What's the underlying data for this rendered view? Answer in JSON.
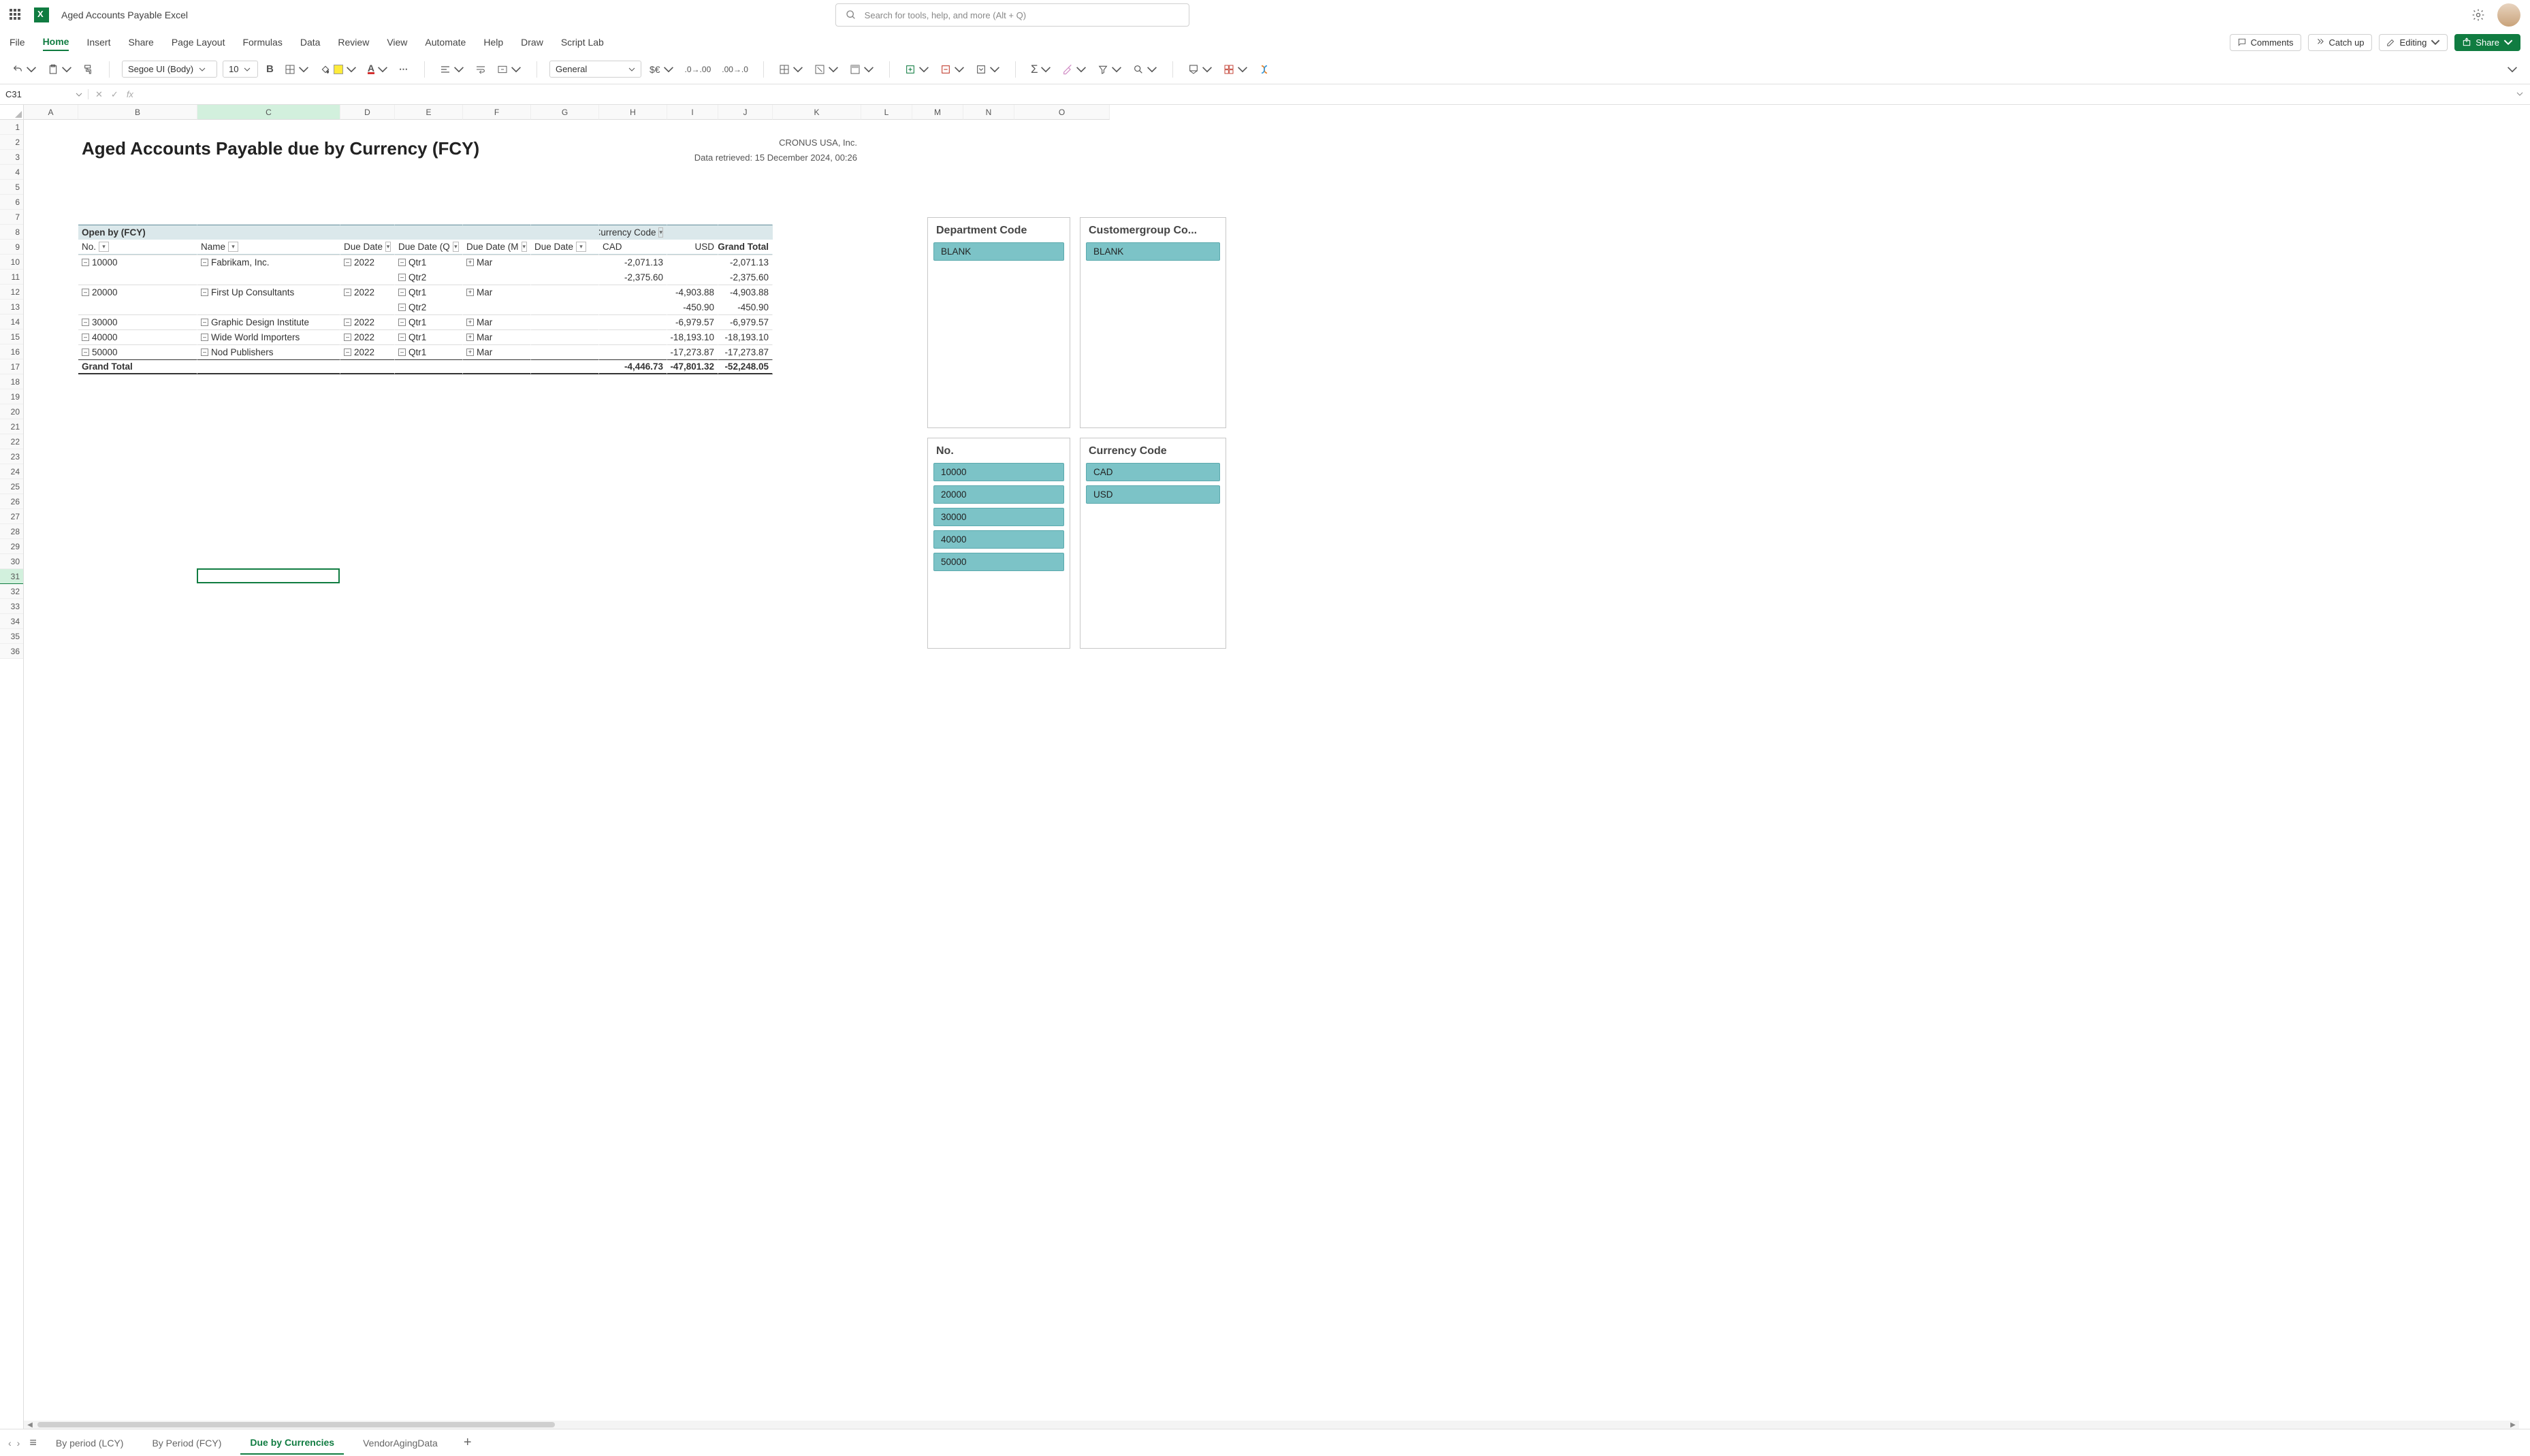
{
  "doc_title": "Aged Accounts Payable Excel",
  "search_placeholder": "Search for tools, help, and more (Alt + Q)",
  "ribbon_tabs": [
    "File",
    "Home",
    "Insert",
    "Share",
    "Page Layout",
    "Formulas",
    "Data",
    "Review",
    "View",
    "Automate",
    "Help",
    "Draw",
    "Script Lab"
  ],
  "ribbon_buttons": {
    "comments": "Comments",
    "catchup": "Catch up",
    "editing": "Editing",
    "share": "Share"
  },
  "font_name": "Segoe UI (Body)",
  "font_size": "10",
  "number_format": "General",
  "name_box": "C31",
  "formula_value": "",
  "col_headers": [
    "A",
    "B",
    "C",
    "D",
    "E",
    "F",
    "G",
    "H",
    "I",
    "J",
    "K",
    "L",
    "M",
    "N",
    "O"
  ],
  "selected_col": "C",
  "selected_row": 31,
  "row_count": 36,
  "report": {
    "title": "Aged Accounts Payable due by Currency (FCY)",
    "company": "CRONUS USA, Inc.",
    "retrieved": "Data retrieved: 15 December 2024, 00:26",
    "open_by": "Open by (FCY)",
    "currency_code_label": "Currency Code",
    "col_filters": [
      "No.",
      "Name",
      "Due Date",
      "Due Date (Q",
      "Due Date (M",
      "Due Date"
    ],
    "val_cols": [
      "CAD",
      "USD",
      "Grand Total"
    ],
    "rows": [
      {
        "no": "10000",
        "name": "Fabrikam, Inc.",
        "y": "2022",
        "q": "Qtr1",
        "m": "Mar",
        "cad": "-2,071.13",
        "usd": "",
        "gt": "-2,071.13"
      },
      {
        "no": "",
        "name": "",
        "y": "",
        "q": "Qtr2",
        "m": "",
        "cad": "-2,375.60",
        "usd": "",
        "gt": "-2,375.60"
      },
      {
        "no": "20000",
        "name": "First Up Consultants",
        "y": "2022",
        "q": "Qtr1",
        "m": "Mar",
        "cad": "",
        "usd": "-4,903.88",
        "gt": "-4,903.88"
      },
      {
        "no": "",
        "name": "",
        "y": "",
        "q": "Qtr2",
        "m": "",
        "cad": "",
        "usd": "-450.90",
        "gt": "-450.90"
      },
      {
        "no": "30000",
        "name": "Graphic Design Institute",
        "y": "2022",
        "q": "Qtr1",
        "m": "Mar",
        "cad": "",
        "usd": "-6,979.57",
        "gt": "-6,979.57"
      },
      {
        "no": "40000",
        "name": "Wide World Importers",
        "y": "2022",
        "q": "Qtr1",
        "m": "Mar",
        "cad": "",
        "usd": "-18,193.10",
        "gt": "-18,193.10"
      },
      {
        "no": "50000",
        "name": "Nod Publishers",
        "y": "2022",
        "q": "Qtr1",
        "m": "Mar",
        "cad": "",
        "usd": "-17,273.87",
        "gt": "-17,273.87"
      }
    ],
    "grand_total": {
      "label": "Grand Total",
      "cad": "-4,446.73",
      "usd": "-47,801.32",
      "gt": "-52,248.05"
    }
  },
  "slicers": [
    {
      "title": "Department Code",
      "items": [
        "BLANK"
      ]
    },
    {
      "title": "Customergroup Co...",
      "items": [
        "BLANK"
      ]
    },
    {
      "title": "No.",
      "items": [
        "10000",
        "20000",
        "30000",
        "40000",
        "50000"
      ]
    },
    {
      "title": "Currency Code",
      "items": [
        "CAD",
        "USD"
      ]
    }
  ],
  "sheets": [
    "By period (LCY)",
    "By Period (FCY)",
    "Due by Currencies",
    "VendorAgingData"
  ],
  "active_sheet": 2
}
